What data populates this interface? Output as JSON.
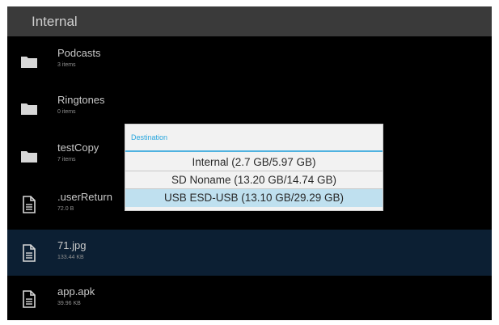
{
  "header": {
    "title": "Internal"
  },
  "files": [
    {
      "name": "Podcasts",
      "detail": "3 items",
      "icon": "folder-icon"
    },
    {
      "name": "Ringtones",
      "detail": "0 items",
      "icon": "folder-icon"
    },
    {
      "name": "testCopy",
      "detail": "7 items",
      "icon": "folder-icon"
    },
    {
      "name": ".userReturn",
      "detail": "72.0 B",
      "icon": "file-icon"
    },
    {
      "name": "71.jpg",
      "detail": "133.44 KB",
      "icon": "file-icon"
    },
    {
      "name": "app.apk",
      "detail": "39.96 KB",
      "icon": "file-icon"
    }
  ],
  "dialog": {
    "title": "Destination",
    "options": [
      {
        "label": "Internal (2.7 GB/5.97 GB)"
      },
      {
        "label": "SD Noname (13.20 GB/14.74 GB)"
      },
      {
        "label": "USB ESD-USB (13.10 GB/29.29 GB)",
        "selected": true
      }
    ]
  },
  "colors": {
    "background": "#000000",
    "titlebar": "#3a3a3a",
    "selected_row": "#0c1f33",
    "dialog_accent": "#2aa7de",
    "dialog_selected": "#bfe0ef"
  }
}
